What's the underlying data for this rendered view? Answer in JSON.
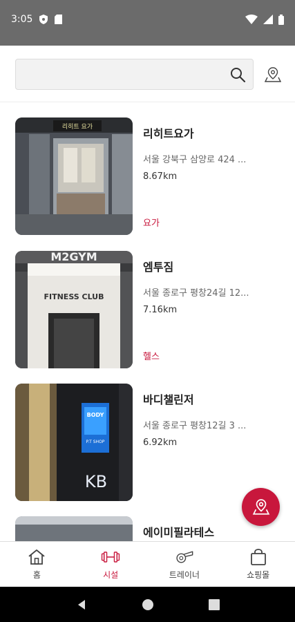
{
  "status_bar": {
    "time": "3:05"
  },
  "search": {
    "placeholder": "",
    "value": ""
  },
  "facilities": [
    {
      "name": "리히트요가",
      "address": "서울 강북구 삼양로 424 ...",
      "distance": "8.67km",
      "category": "요가"
    },
    {
      "name": "엠투짐",
      "address": "서울 종로구 평창24길 12...",
      "distance": "7.16km",
      "category": "헬스"
    },
    {
      "name": "바디챌린저",
      "address": "서울 종로구 평창12길 3 ...",
      "distance": "6.92km",
      "category": ""
    },
    {
      "name": "에이미필라테스",
      "address": "",
      "distance": "",
      "category": ""
    }
  ],
  "thumb_text": {
    "yoga_sign": "리히트 요가",
    "fitness_club": "FITNESS CLUB",
    "m2gym": "M2GYM",
    "body_sign": "BODY",
    "pt_shop": "P.T SHOP",
    "kb": "KB"
  },
  "bottom_nav": [
    {
      "label": "홈",
      "icon": "home-icon",
      "active": false
    },
    {
      "label": "시설",
      "icon": "dumbbell-icon",
      "active": true
    },
    {
      "label": "트레이너",
      "icon": "whistle-icon",
      "active": false
    },
    {
      "label": "쇼핑몰",
      "icon": "shopping-bag-icon",
      "active": false
    }
  ],
  "colors": {
    "accent": "#c8173c",
    "status_bar": "#6b6b6b"
  }
}
